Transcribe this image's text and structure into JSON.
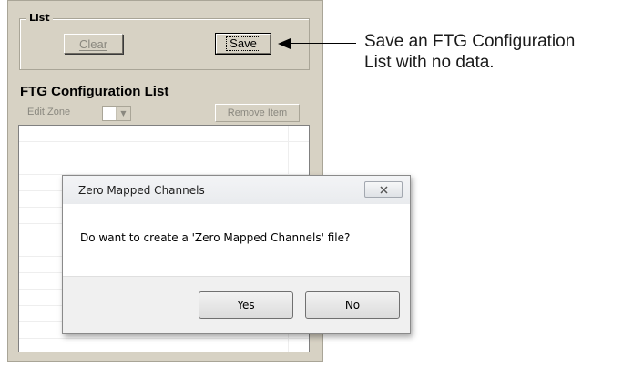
{
  "list_group": {
    "legend": "List",
    "clear_label": "Clear",
    "save_label": "Save"
  },
  "ftg": {
    "title": "FTG Configuration List",
    "edit_zone_label": "Edit Zone",
    "remove_label": "Remove Item"
  },
  "dialog": {
    "title": "Zero Mapped Channels",
    "message": "Do want to create a 'Zero Mapped Channels' file?",
    "yes_label": "Yes",
    "no_label": "No",
    "close_icon": "close-icon"
  },
  "annotation": {
    "line1": "Save an FTG Configuration",
    "line2": "List with no data."
  },
  "colors": {
    "panel_bg": "#d7d2c4",
    "disabled_text": "#8a887f",
    "dialog_footer": "#f0f0f0"
  }
}
